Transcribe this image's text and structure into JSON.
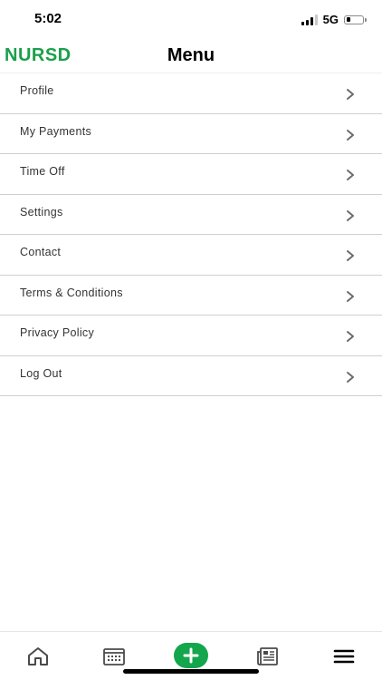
{
  "status_bar": {
    "time": "5:02",
    "network": "5G"
  },
  "header": {
    "brand": "NURSD",
    "title": "Menu",
    "brand_color": "#1aa04a"
  },
  "menu": {
    "items": [
      {
        "label": "Profile"
      },
      {
        "label": "My Payments"
      },
      {
        "label": "Time Off"
      },
      {
        "label": "Settings"
      },
      {
        "label": "Contact"
      },
      {
        "label": "Terms & Conditions"
      },
      {
        "label": "Privacy Policy"
      },
      {
        "label": "Log Out"
      }
    ]
  },
  "tab_bar": {
    "tabs": [
      {
        "icon": "home-icon"
      },
      {
        "icon": "calendar-icon"
      },
      {
        "icon": "add-icon"
      },
      {
        "icon": "newspaper-icon"
      },
      {
        "icon": "menu-icon"
      }
    ],
    "accent_color": "#14a64c"
  }
}
